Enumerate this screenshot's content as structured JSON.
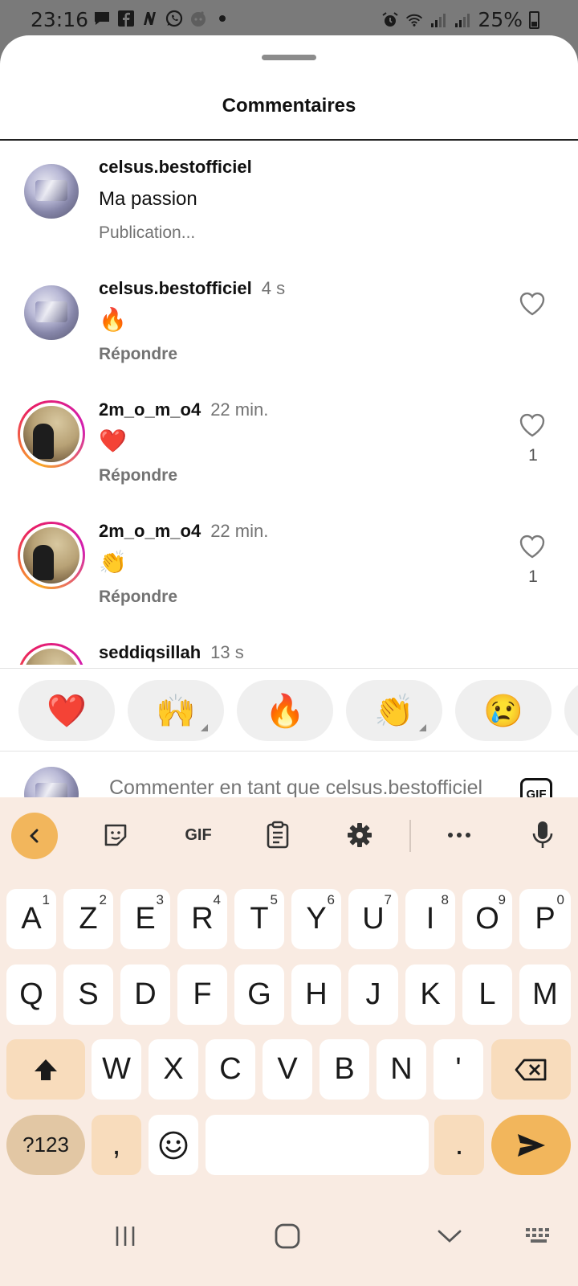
{
  "status_bar": {
    "time": "23:16",
    "battery": "25%",
    "left_icons": [
      "message-icon",
      "facebook-icon",
      "news-icon",
      "whatsapp-icon",
      "reddit-icon",
      "dot-icon"
    ],
    "right_icons": [
      "alarm-icon",
      "wifi-icon",
      "signal-icon",
      "signal-icon",
      "battery-icon"
    ]
  },
  "sheet": {
    "title": "Commentaires"
  },
  "caption": {
    "username": "celsus.bestofficiel",
    "text": "Ma passion",
    "more": "Publication..."
  },
  "comments": [
    {
      "username": "celsus.bestofficiel",
      "time": "4 s",
      "text": "🔥",
      "reply": "Répondre",
      "likes": ""
    },
    {
      "username": "2m_o_m_o4",
      "time": "22 min.",
      "text": "❤️",
      "reply": "Répondre",
      "likes": "1"
    },
    {
      "username": "2m_o_m_o4",
      "time": "22 min.",
      "text": "👏",
      "reply": "Répondre",
      "likes": "1"
    },
    {
      "username": "seddiqsillah",
      "time": "13 s",
      "text": "",
      "reply": "",
      "likes": ""
    }
  ],
  "quick_reactions": [
    "❤️",
    "🙌",
    "🔥",
    "👏",
    "😢"
  ],
  "compose": {
    "placeholder": "Commenter en tant que celsus.bestofficiel",
    "gif_label": "GIF"
  },
  "keyboard": {
    "toolbar_gif": "GIF",
    "row1": [
      {
        "k": "A",
        "s": "1"
      },
      {
        "k": "Z",
        "s": "2"
      },
      {
        "k": "E",
        "s": "3"
      },
      {
        "k": "R",
        "s": "4"
      },
      {
        "k": "T",
        "s": "5"
      },
      {
        "k": "Y",
        "s": "6"
      },
      {
        "k": "U",
        "s": "7"
      },
      {
        "k": "I",
        "s": "8"
      },
      {
        "k": "O",
        "s": "9"
      },
      {
        "k": "P",
        "s": "0"
      }
    ],
    "row2": [
      "Q",
      "S",
      "D",
      "F",
      "G",
      "H",
      "J",
      "K",
      "L",
      "M"
    ],
    "row3": [
      "W",
      "X",
      "C",
      "V",
      "B",
      "N",
      "'"
    ],
    "sym_label": "?123",
    "comma": ",",
    "period": "."
  },
  "colors": {
    "accent": "#f2b65c",
    "keyboard_bg": "#f9ebe2",
    "story_ring_start": "#f9a825",
    "story_ring_end": "#d21fb2"
  }
}
